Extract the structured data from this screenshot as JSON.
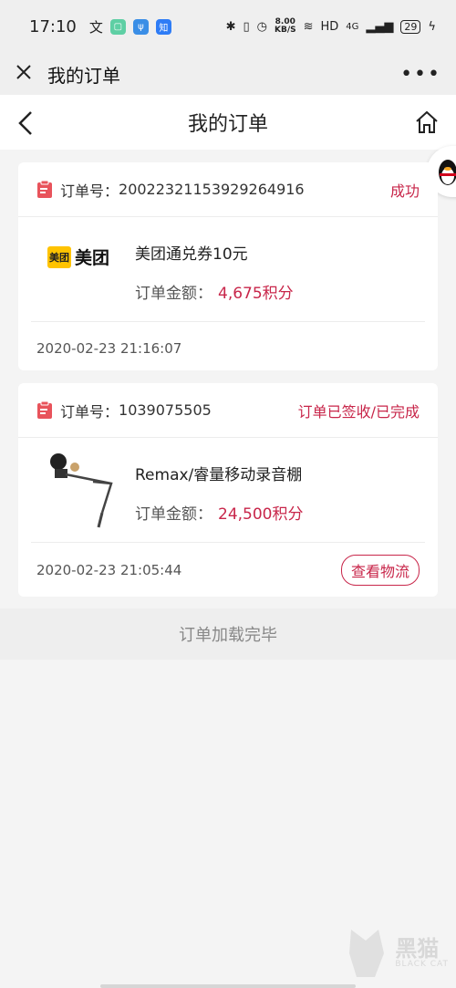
{
  "status_bar": {
    "time": "17:10",
    "net_speed_value": "8.00",
    "net_speed_unit": "KB/S",
    "hd": "HD",
    "signal": "4G",
    "battery": "29"
  },
  "webview_header": {
    "title": "我的订单"
  },
  "page_header": {
    "title": "我的订单"
  },
  "orders": [
    {
      "order_label": "订单号：",
      "order_no": "20022321153929264916",
      "status": "成功",
      "logo_box_text": "美团",
      "logo_text": "美团",
      "product_name": "美团通兑券10元",
      "amount_label": "订单金额：",
      "amount_value": "4,675积分",
      "datetime": "2020-02-23 21:16:07"
    },
    {
      "order_label": "订单号：",
      "order_no": "1039075505",
      "status": "订单已签收/已完成",
      "product_name": "Remax/睿量移动录音棚",
      "amount_label": "订单金额：",
      "amount_value": "24,500积分",
      "datetime": "2020-02-23 21:05:44",
      "button": "查看物流"
    }
  ],
  "footer": {
    "load_done": "订单加载完毕"
  },
  "watermark": {
    "text": "黑猫",
    "sub": "BLACK CAT"
  },
  "colors": {
    "accent": "#c8264a",
    "meituan_yellow": "#ffc300"
  }
}
